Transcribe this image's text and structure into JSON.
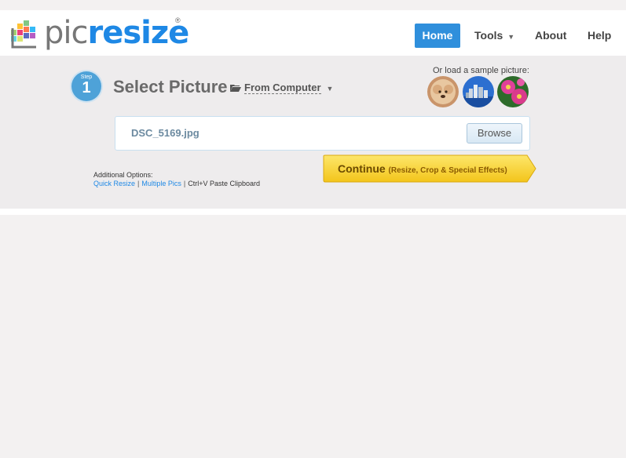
{
  "brand": {
    "name_part1": "pic",
    "name_part2": "resize",
    "registered": "®"
  },
  "nav": {
    "home": "Home",
    "tools": "Tools",
    "about": "About",
    "help": "Help",
    "active": "Home",
    "active_color": "#2f8fdc"
  },
  "step": {
    "label": "Step",
    "number": "1",
    "title": "Select Picture",
    "source_label": "From Computer"
  },
  "samples": {
    "label": "Or load a sample picture:",
    "items": [
      "dog-photo",
      "city-skyline-photo",
      "pink-flowers-photo"
    ]
  },
  "file": {
    "name": "DSC_5169.jpg",
    "browse_label": "Browse"
  },
  "continue": {
    "label": "Continue",
    "sub_label": "(Resize, Crop & Special Effects)",
    "color": "#f9d629"
  },
  "options": {
    "heading": "Additional Options:",
    "quick_resize": "Quick Resize",
    "multiple_pics": "Multiple Pics",
    "clipboard": "Ctrl+V Paste Clipboard",
    "separator": "|"
  }
}
